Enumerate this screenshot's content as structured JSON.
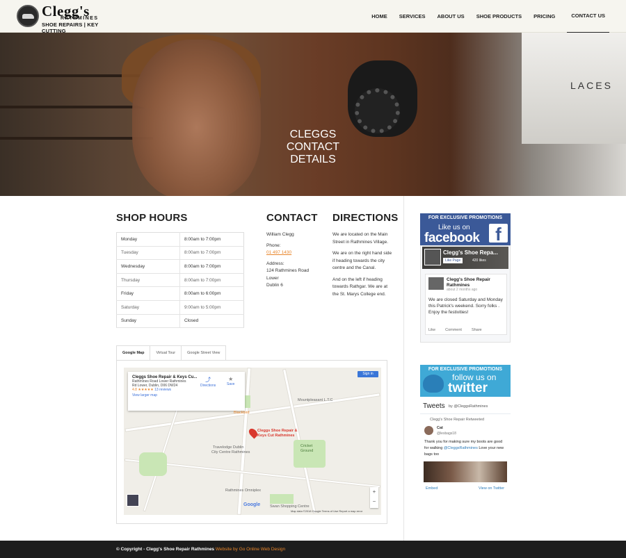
{
  "header": {
    "logo_name": "Clegg's",
    "logo_sub1": "RATHMINES",
    "logo_sub2": "SHOE REPAIRS | KEY CUTTING",
    "nav": [
      "HOME",
      "SERVICES",
      "ABOUT US",
      "SHOE PRODUCTS",
      "PRICING",
      "CONTACT US"
    ],
    "active_nav": "CONTACT US"
  },
  "hero": {
    "title_line1": "CLEGGS",
    "title_line2": "CONTACT",
    "title_line3": "DETAILS",
    "boxes_text": "LACES"
  },
  "shop_hours": {
    "heading": "SHOP HOURS",
    "rows": [
      {
        "day": "Monday",
        "hours": "8:00am to 7:00pm"
      },
      {
        "day": "Tuesday",
        "hours": "8:00am to 7:00pm"
      },
      {
        "day": "Wednesday",
        "hours": "8:00am to 7:00pm"
      },
      {
        "day": "Thursday",
        "hours": "8:00am to 7:00pm"
      },
      {
        "day": "Friday",
        "hours": "8:00am to 6:00pm"
      },
      {
        "day": "Saturday",
        "hours": "9:00am to 5:00pm"
      },
      {
        "day": "Sunday",
        "hours": "Closed"
      }
    ]
  },
  "contact": {
    "heading": "CONTACT",
    "name": "William Clegg",
    "phone_label": "Phone:",
    "phone": "01 497 1430",
    "address_label": "Address:",
    "address1": "124 Rathmines Road",
    "address2": "Lower",
    "address3": "Dublin 6"
  },
  "directions": {
    "heading": "DIRECTIONS",
    "p1": "We are located on the Main Street in Rathmines Village.",
    "p2": "We are on the right hand side if heading towards the city centre and the Canal.",
    "p3": "And on the left if heading towards Rathgar. We are at the St. Marys College end."
  },
  "map_tabs": [
    "Google Map",
    "Virtual Tour",
    "Google Street View"
  ],
  "map": {
    "card_title": "Cleggs Shoe Repair & Keys Cu...",
    "card_addr1": "Rathmines Road Lower Rathmines",
    "card_addr2": "Rd Lower, Dublin, D06 DW24",
    "rating": "4.8 ★★★★★",
    "reviews": "13 reviews",
    "larger": "View larger map",
    "directions": "Directions",
    "save": "Save",
    "sign_in": "Sign in",
    "pin_label1": "Cleggs Shoe Repair &",
    "pin_label2": "Keys Cut Rathmines",
    "labels": [
      "Mountpleasant L.T.C",
      "Blackbird",
      "Travelodge Dublin",
      "City Centre Rathmines",
      "Cricket",
      "Ground",
      "Rathmines Omniplex",
      "Swan Shopping Centre"
    ],
    "footer": "Map data ©2018 Google   Terms of Use   Report a map error",
    "google": "Google"
  },
  "facebook": {
    "promo": "FOR EXCLUSIVE PROMOTIONS",
    "like_us": "Like us on",
    "brand": "facebook",
    "page_name": "Clegg's Shoe Repa...",
    "like_page": "Like Page",
    "likes": "420 likes",
    "post_title": "Clegg's Shoe Repair Rathmines",
    "post_meta": "about 2 months ago",
    "post_body": "We are closed Saturday and Monday this Patrick's weekend. Sorry folks . Enjoy the festivities!",
    "actions": [
      "Like",
      "Comment",
      "Share"
    ]
  },
  "twitter": {
    "promo": "FOR EXCLUSIVE PROMOTIONS",
    "follow": "follow us on",
    "brand": "twitter",
    "heading": "Tweets",
    "by": "by @CleggsRathmines",
    "retweeted": "Clegg's Shoe Repair Retweeted",
    "user": "Cat",
    "handle": "@lesbags18",
    "body_a": "Thank you for making sure my boots are good for walking ",
    "mention": "@CleggsRathmines",
    "body_b": " Love your new bags too",
    "embed": "Embed",
    "view": "View on Twitter"
  },
  "footer": {
    "copyright": "© Copyright - Clegg's Shoe Repair Rathmines ",
    "credit": "Website by Go Online Web Design"
  },
  "colors": {
    "accent": "#e8852a",
    "facebook": "#3b5998",
    "twitter": "#3fa9d6",
    "footer": "#1d1d1d"
  }
}
